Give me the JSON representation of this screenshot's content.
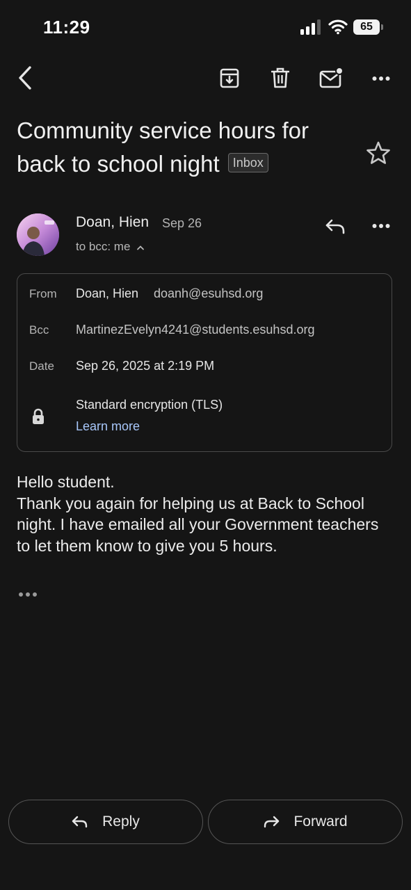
{
  "status_bar": {
    "time": "11:29",
    "battery": "65"
  },
  "email": {
    "subject": "Community service hours for back to school night",
    "label": "Inbox",
    "sender_name": "Doan, Hien",
    "date_short": "Sep 26",
    "to_line": "to bcc: me",
    "details": {
      "from_label": "From",
      "from_name": "Doan, Hien",
      "from_email": "doanh@esuhsd.org",
      "bcc_label": "Bcc",
      "bcc_value": "MartinezEvelyn4241@students.esuhsd.org",
      "date_label": "Date",
      "date_value": "Sep 26, 2025 at 2:19 PM",
      "encryption": "Standard encryption (TLS)",
      "learn_more": "Learn more"
    },
    "body_lines": [
      "Hello student.",
      "Thank you again for helping us at Back to School night. I have emailed all your Government teachers to let them know to give you 5 hours."
    ]
  },
  "actions": {
    "reply": "Reply",
    "forward": "Forward"
  },
  "icons": {
    "back": "chevron-left-icon",
    "archive": "archive-icon",
    "delete": "trash-icon",
    "mark_unread": "mail-unread-icon",
    "more": "more-horizontal-icon",
    "star": "star-outline-icon",
    "reply": "reply-icon",
    "lock": "lock-icon",
    "forward": "forward-icon"
  },
  "colors": {
    "background": "#151515",
    "link": "#a8c7fa",
    "text": "#ececec"
  }
}
